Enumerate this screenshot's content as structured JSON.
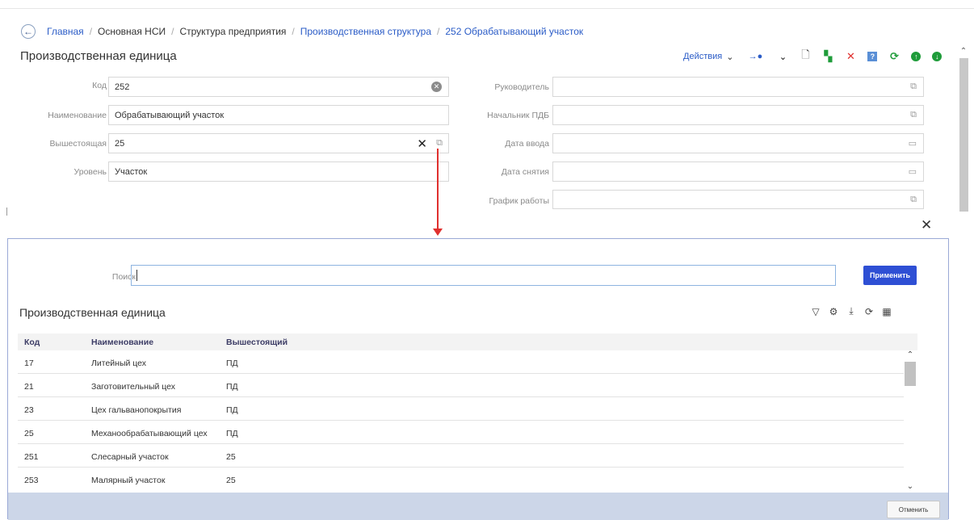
{
  "breadcrumb": {
    "back_icon": "arrow-left-icon",
    "items": [
      "Главная",
      "Основная НСИ",
      "Структура предприятия",
      "Производственная структура",
      "252 Обрабатывающий участок"
    ]
  },
  "page_title": "Производственная единица",
  "toolbar": {
    "actions_label": "Действия",
    "icons": [
      "chevron-down-icon",
      "route-icon",
      "new-document-icon",
      "copy-icon",
      "delete-icon",
      "help-icon",
      "refresh-icon",
      "move-up-icon",
      "move-down-icon"
    ],
    "colors": {
      "link": "#2b5cc7",
      "copy": "#1f9c3a",
      "delete": "#e0302e",
      "help": "#5a8fd6",
      "refresh": "#1f9c3a"
    }
  },
  "form": {
    "code": {
      "label": "Код",
      "value": "252"
    },
    "name": {
      "label": "Наименование",
      "value": "Обрабатывающий участок"
    },
    "parent": {
      "label": "Вышестоящая",
      "value": "25"
    },
    "level": {
      "label": "Уровень",
      "value": "Участок"
    },
    "head": {
      "label": "Руководитель",
      "value": ""
    },
    "pdb_head": {
      "label": "Начальник ПДБ",
      "value": ""
    },
    "start_date": {
      "label": "Дата ввода",
      "value": ""
    },
    "end_date": {
      "label": "Дата снятия",
      "value": ""
    },
    "schedule": {
      "label": "График работы",
      "value": ""
    }
  },
  "modal": {
    "search_label": "Поиск",
    "search_value": "",
    "apply_label": "Применить",
    "title": "Производственная единица",
    "columns": [
      "Код",
      "Наименование",
      "Вышестоящий"
    ],
    "rows": [
      [
        "17",
        "Литейный цех",
        "ПД"
      ],
      [
        "21",
        "Заготовительный цех",
        "ПД"
      ],
      [
        "23",
        "Цех гальванопокрытия",
        "ПД"
      ],
      [
        "25",
        "Механообрабатывающий цех",
        "ПД"
      ],
      [
        "251",
        "Слесарный участок",
        "25"
      ],
      [
        "253",
        "Малярный участок",
        "25"
      ]
    ],
    "cancel_label": "Отменить"
  }
}
